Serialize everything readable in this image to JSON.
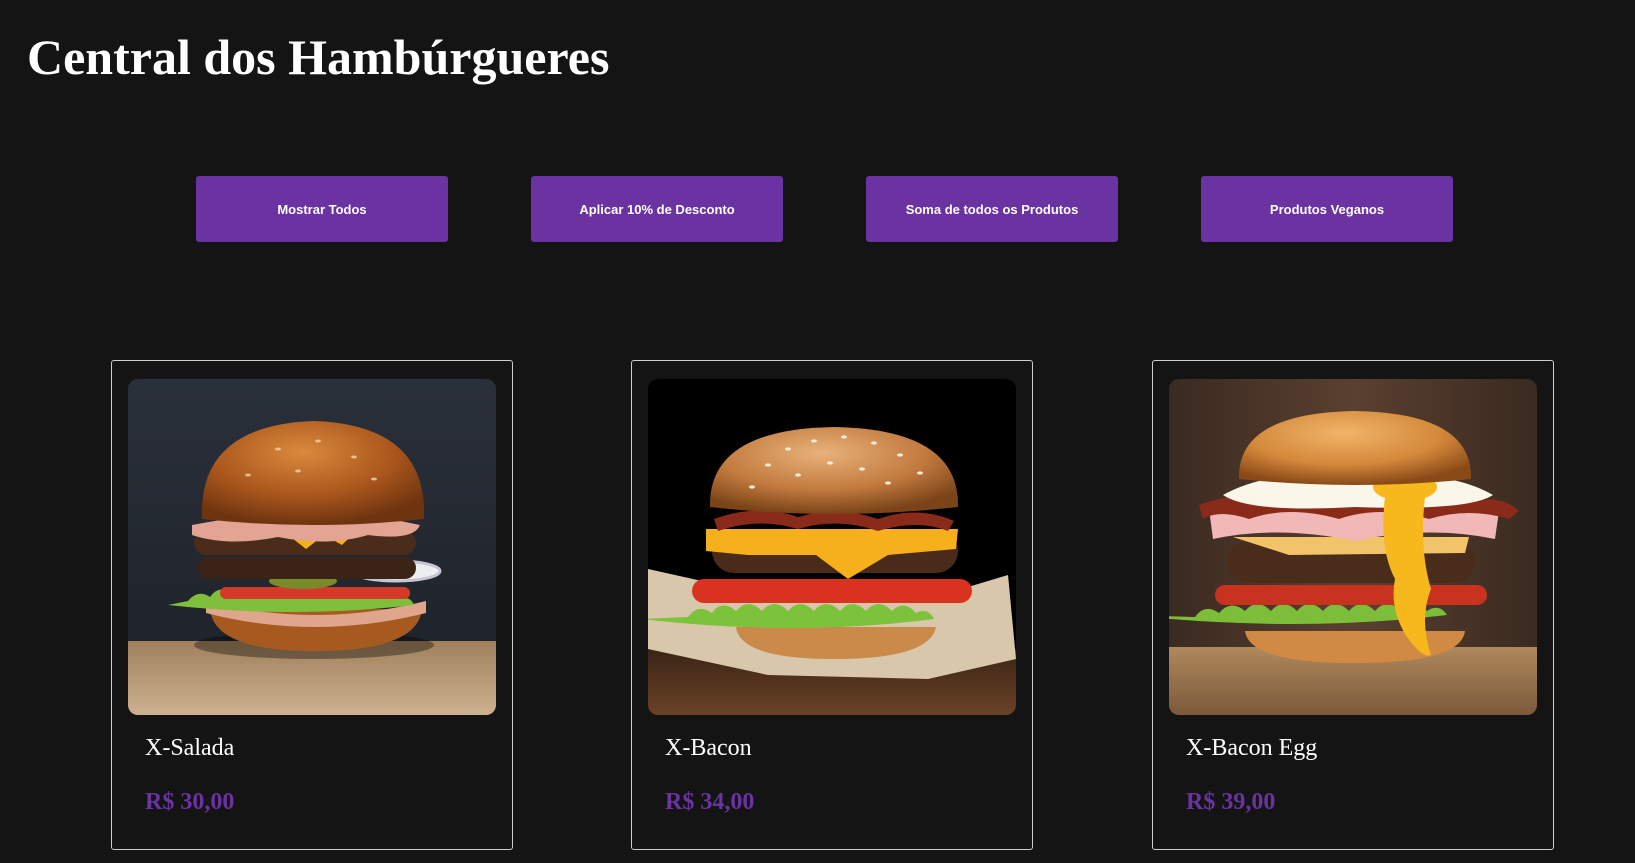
{
  "header": {
    "title": "Central dos Hambúrgueres"
  },
  "actions": [
    {
      "label": "Mostrar Todos"
    },
    {
      "label": "Aplicar 10% de Desconto"
    },
    {
      "label": "Soma de todos os Produtos"
    },
    {
      "label": "Produtos Veganos"
    }
  ],
  "products": [
    {
      "name": "X-Salada",
      "price": "R$ 30,00"
    },
    {
      "name": "X-Bacon",
      "price": "R$ 34,00"
    },
    {
      "name": "X-Bacon Egg",
      "price": "R$ 39,00"
    }
  ],
  "colors": {
    "background": "#141414",
    "accent": "#6b33a1",
    "card_border": "#cfcfcf",
    "text": "#ffffff"
  }
}
